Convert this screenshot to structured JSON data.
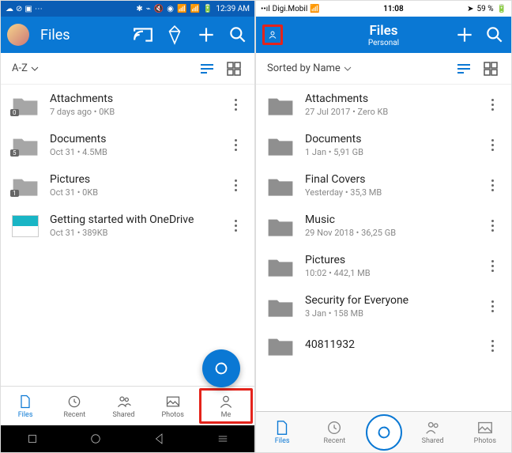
{
  "android": {
    "status": {
      "time": "12:39 AM"
    },
    "title": "Files",
    "sort": "A-Z",
    "items": [
      {
        "title": "Attachments",
        "sub": "7 days ago • 0KB",
        "badge": "0",
        "type": "folder"
      },
      {
        "title": "Documents",
        "sub": "Oct 31 • 4.5MB",
        "badge": "5",
        "type": "folder"
      },
      {
        "title": "Pictures",
        "sub": "Oct 31 • 0KB",
        "badge": "1",
        "type": "folder"
      },
      {
        "title": "Getting started with OneDrive",
        "sub": "Oct 31 • 389KB",
        "type": "file"
      }
    ],
    "nav": [
      "Files",
      "Recent",
      "Shared",
      "Photos",
      "Me"
    ]
  },
  "ios": {
    "status": {
      "carrier": "Digi.Mobil",
      "time": "11:08",
      "battery": "59 %"
    },
    "title": "Files",
    "subtitle": "Personal",
    "sort": "Sorted by Name",
    "items": [
      {
        "title": "Attachments",
        "sub": "27 Jul 2017 • Zero KB"
      },
      {
        "title": "Documents",
        "sub": "1 Jan • 5,91 GB"
      },
      {
        "title": "Final Covers",
        "sub": "Yesterday • 35,3 MB"
      },
      {
        "title": "Music",
        "sub": "29 Nov 2018 • 36,25 GB"
      },
      {
        "title": "Pictures",
        "sub": "10:02 • 442,1 MB"
      },
      {
        "title": "Security for Everyone",
        "sub": "3 Jan • 158 MB"
      },
      {
        "title": "40811932",
        "sub": ""
      }
    ],
    "nav": [
      "Files",
      "Recent",
      "",
      "Shared",
      "Photos"
    ]
  }
}
